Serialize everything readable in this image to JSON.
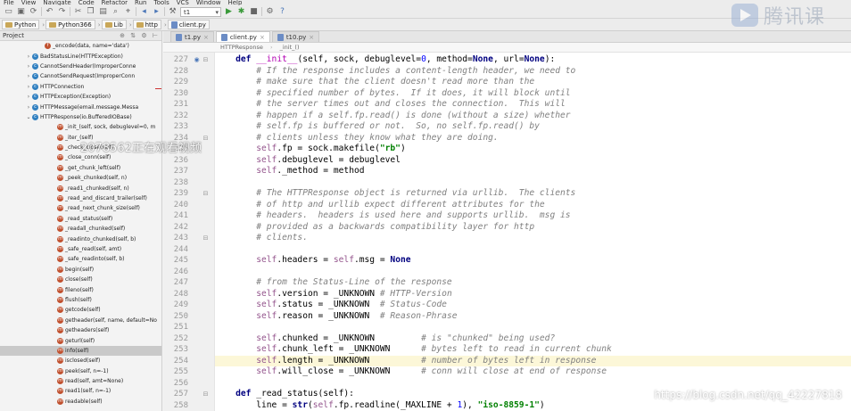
{
  "menubar": {
    "items": [
      "File",
      "View",
      "Navigate",
      "Code",
      "Refactor",
      "Run",
      "Tools",
      "VCS",
      "Window",
      "Help"
    ]
  },
  "toolbar": {
    "run_config": "t1"
  },
  "navbar": {
    "crumbs": [
      "Python",
      "Python366",
      "Lib",
      "http",
      "client.py"
    ]
  },
  "sidebar": {
    "title": "Project",
    "rows": [
      {
        "indent": 2,
        "arrow": "",
        "icon": "f",
        "label": "_encode(data, name='data')"
      },
      {
        "indent": 1,
        "arrow": "›",
        "icon": "c",
        "label": "BadStatusLine(HTTPException)"
      },
      {
        "indent": 1,
        "arrow": "›",
        "icon": "c",
        "label": "CannotSendHeader(ImproperConne"
      },
      {
        "indent": 1,
        "arrow": "›",
        "icon": "c",
        "label": "CannotSendRequest(ImproperConn"
      },
      {
        "indent": 1,
        "arrow": "›",
        "icon": "c",
        "label": "HTTPConnection"
      },
      {
        "indent": 1,
        "arrow": "›",
        "icon": "c",
        "label": "HTTPException(Exception)"
      },
      {
        "indent": 1,
        "arrow": "›",
        "icon": "c",
        "label": "HTTPMessage(email.message.Messa"
      },
      {
        "indent": 1,
        "arrow": "⌄",
        "icon": "c",
        "label": "HTTPResponse(io.BufferedIOBase)"
      },
      {
        "indent": 3,
        "arrow": "",
        "icon": "m",
        "label": "_init_(self, sock, debuglevel=0, m"
      },
      {
        "indent": 3,
        "arrow": "",
        "icon": "m",
        "label": "_iter_(self)"
      },
      {
        "indent": 3,
        "arrow": "",
        "icon": "m",
        "label": "_check_close(self)"
      },
      {
        "indent": 3,
        "arrow": "",
        "icon": "m",
        "label": "_close_conn(self)"
      },
      {
        "indent": 3,
        "arrow": "",
        "icon": "m",
        "label": "_get_chunk_left(self)"
      },
      {
        "indent": 3,
        "arrow": "",
        "icon": "m",
        "label": "_peek_chunked(self, n)"
      },
      {
        "indent": 3,
        "arrow": "",
        "icon": "m",
        "label": "_read1_chunked(self, n)"
      },
      {
        "indent": 3,
        "arrow": "",
        "icon": "m",
        "label": "_read_and_discard_trailer(self)"
      },
      {
        "indent": 3,
        "arrow": "",
        "icon": "m",
        "label": "_read_next_chunk_size(self)"
      },
      {
        "indent": 3,
        "arrow": "",
        "icon": "m",
        "label": "_read_status(self)"
      },
      {
        "indent": 3,
        "arrow": "",
        "icon": "m",
        "label": "_readall_chunked(self)"
      },
      {
        "indent": 3,
        "arrow": "",
        "icon": "m",
        "label": "_readinto_chunked(self, b)"
      },
      {
        "indent": 3,
        "arrow": "",
        "icon": "m",
        "label": "_safe_read(self, amt)"
      },
      {
        "indent": 3,
        "arrow": "",
        "icon": "m",
        "label": "_safe_readinto(self, b)"
      },
      {
        "indent": 3,
        "arrow": "",
        "icon": "m",
        "label": "begin(self)"
      },
      {
        "indent": 3,
        "arrow": "",
        "icon": "m",
        "label": "close(self)"
      },
      {
        "indent": 3,
        "arrow": "",
        "icon": "m",
        "label": "fileno(self)"
      },
      {
        "indent": 3,
        "arrow": "",
        "icon": "m",
        "label": "flush(self)"
      },
      {
        "indent": 3,
        "arrow": "",
        "icon": "m",
        "label": "getcode(self)"
      },
      {
        "indent": 3,
        "arrow": "",
        "icon": "m",
        "label": "getheader(self, name, default=No"
      },
      {
        "indent": 3,
        "arrow": "",
        "icon": "m",
        "label": "getheaders(self)"
      },
      {
        "indent": 3,
        "arrow": "",
        "icon": "m",
        "label": "geturl(self)"
      },
      {
        "indent": 3,
        "arrow": "",
        "icon": "m",
        "label": "info(self)",
        "selected": true
      },
      {
        "indent": 3,
        "arrow": "",
        "icon": "m",
        "label": "isclosed(self)"
      },
      {
        "indent": 3,
        "arrow": "",
        "icon": "m",
        "label": "peek(self, n=-1)"
      },
      {
        "indent": 3,
        "arrow": "",
        "icon": "m",
        "label": "read(self, amt=None)"
      },
      {
        "indent": 3,
        "arrow": "",
        "icon": "m",
        "label": "read1(self, n=-1)"
      },
      {
        "indent": 3,
        "arrow": "",
        "icon": "m",
        "label": "readable(self)"
      }
    ]
  },
  "editor": {
    "tabs": [
      {
        "label": "t1.py",
        "active": false
      },
      {
        "label": "client.py",
        "active": true
      },
      {
        "label": "t10.py",
        "active": false
      }
    ],
    "breadcrumb": [
      "HTTPResponse",
      "_init_()"
    ],
    "highlighted_line": 254,
    "lines": [
      {
        "n": 227,
        "html": "    <span class='kw'>def</span> <span class='dd'>__init__</span>(self, sock, debuglevel=<span class='nm'>0</span>, method=<span class='kw'>None</span>, url=<span class='kw'>None</span>):"
      },
      {
        "n": 228,
        "html": "        <span class='cm'># If the response includes a content-length header, we need to</span>"
      },
      {
        "n": 229,
        "html": "        <span class='cm'># make sure that the client doesn't read more than the</span>"
      },
      {
        "n": 230,
        "html": "        <span class='cm'># specified number of bytes.  If it does, it will block until</span>"
      },
      {
        "n": 231,
        "html": "        <span class='cm'># the server times out and closes the connection.  This will</span>"
      },
      {
        "n": 232,
        "html": "        <span class='cm'># happen if a self.fp.read() is done (without a size) whether</span>"
      },
      {
        "n": 233,
        "html": "        <span class='cm'># self.fp is buffered or not.  So, no self.fp.read() by</span>"
      },
      {
        "n": 234,
        "html": "        <span class='cm'># clients unless they know what they are doing.</span>"
      },
      {
        "n": 235,
        "html": "        <span class='sf'>self</span>.fp = sock.makefile(<span class='st'>\"rb\"</span>)"
      },
      {
        "n": 236,
        "html": "        <span class='sf'>self</span>.debuglevel = debuglevel"
      },
      {
        "n": 237,
        "html": "        <span class='sf'>self</span>._method = method"
      },
      {
        "n": 238,
        "html": ""
      },
      {
        "n": 239,
        "html": "        <span class='cm'># The HTTPResponse object is returned via urllib.  The clients</span>"
      },
      {
        "n": 240,
        "html": "        <span class='cm'># of http and urllib expect different attributes for the</span>"
      },
      {
        "n": 241,
        "html": "        <span class='cm'># headers.  headers is used here and supports urllib.  msg is</span>"
      },
      {
        "n": 242,
        "html": "        <span class='cm'># provided as a backwards compatibility layer for http</span>"
      },
      {
        "n": 243,
        "html": "        <span class='cm'># clients.</span>"
      },
      {
        "n": 244,
        "html": ""
      },
      {
        "n": 245,
        "html": "        <span class='sf'>self</span>.headers = <span class='sf'>self</span>.msg = <span class='kw'>None</span>"
      },
      {
        "n": 246,
        "html": ""
      },
      {
        "n": 247,
        "html": "        <span class='cm'># from the Status-Line of the response</span>"
      },
      {
        "n": 248,
        "html": "        <span class='sf'>self</span>.version = _UNKNOWN <span class='cm'># HTTP-Version</span>"
      },
      {
        "n": 249,
        "html": "        <span class='sf'>self</span>.status = _UNKNOWN  <span class='cm'># Status-Code</span>"
      },
      {
        "n": 250,
        "html": "        <span class='sf'>self</span>.reason = _UNKNOWN  <span class='cm'># Reason-Phrase</span>"
      },
      {
        "n": 251,
        "html": ""
      },
      {
        "n": 252,
        "html": "        <span class='sf'>self</span>.chunked = _UNKNOWN         <span class='cm'># is \"chunked\" being used?</span>"
      },
      {
        "n": 253,
        "html": "        <span class='sf'>self</span>.chunk_left = _UNKNOWN      <span class='cm'># bytes left to read in current chunk</span>"
      },
      {
        "n": 254,
        "html": "        <span class='sf'>self</span>.length = _UNKNOWN          <span class='cm'># number of bytes left in response</span>"
      },
      {
        "n": 255,
        "html": "        <span class='sf'>self</span>.will_close = _UNKNOWN      <span class='cm'># conn will close at end of response</span>"
      },
      {
        "n": 256,
        "html": ""
      },
      {
        "n": 257,
        "html": "    <span class='kw'>def</span> _read_status(self):"
      },
      {
        "n": 258,
        "html": "        line = <span class='kw'>str</span>(<span class='sf'>self</span>.fp.readline(_MAXLINE + <span class='nm'>1</span>), <span class='st'>\"iso-8859-1\"</span>)"
      }
    ]
  },
  "overlays": {
    "logo_text": "腾讯课",
    "viewer_text": "2078562正在观看视频",
    "csdn_text": "https://blog.csdn.net/qq_42227818"
  }
}
